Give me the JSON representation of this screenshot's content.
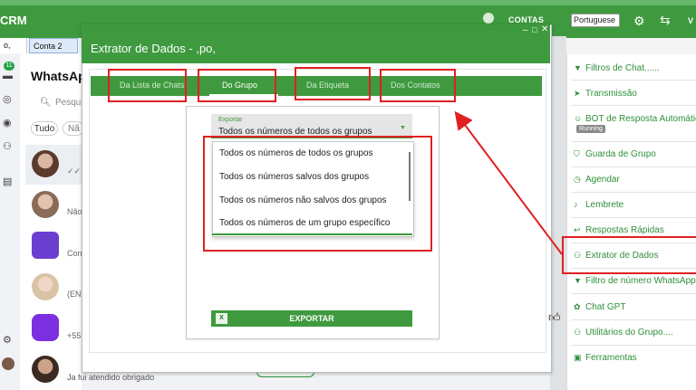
{
  "app": {
    "name": "CRM",
    "contas_label": "CONTAS",
    "language": "Portuguese",
    "user_initial": "V"
  },
  "tabs": [
    {
      "label": "o,"
    },
    {
      "label": "Conta 2"
    }
  ],
  "badge_count": "11",
  "whatsapp": {
    "title": "WhatsApp",
    "search_placeholder": "Pesqui",
    "chips": [
      "Tudo",
      "Nã"
    ],
    "snippets": [
      "✓✓ D",
      "Não",
      "Con",
      "(ENT",
      "+55",
      "Ja fui atendido obrigado"
    ]
  },
  "modal": {
    "title": "Extrator de Dados - ,po,",
    "tabs": [
      "Da Lista de Chats",
      "Do Grupo",
      "Da Etiqueta",
      "Dos Contatos"
    ],
    "select": {
      "label": "Exportar",
      "value": "Todos os números de todos os grupos",
      "options": [
        "Todos os números de todos os grupos",
        "Todos os números salvos dos grupos",
        "Todos os números não salvos dos grupos",
        "Todos os números de um grupo específico"
      ]
    },
    "export_button": "EXPORTAR"
  },
  "sidebar": {
    "items": [
      {
        "label": "Filtros de Chat......",
        "icon": "funnel-icon"
      },
      {
        "label": "Transmissão",
        "icon": "send-icon"
      },
      {
        "label": "BOT de Resposta Automátic",
        "icon": "robot-icon"
      },
      {
        "label": "Guarda de Grupo",
        "icon": "shield-icon"
      },
      {
        "label": "Agendar",
        "icon": "clock-icon"
      },
      {
        "label": "Lembrete",
        "icon": "bell-icon"
      },
      {
        "label": "Respostas Rápidas",
        "icon": "reply-icon"
      },
      {
        "label": "Extrator de Dados",
        "icon": "users-icon"
      },
      {
        "label": "Filtro de número WhatsApp",
        "icon": "funnel-icon"
      },
      {
        "label": "Chat GPT",
        "icon": "gpt-icon"
      },
      {
        "label": "Utilitários do Grupo....",
        "icon": "group-icon"
      },
      {
        "label": "Ferramentas",
        "icon": "briefcase-icon"
      }
    ],
    "running_badge": "Running"
  },
  "colors": {
    "primary_green": "#3f9a3f",
    "annotation_red": "#e02020"
  }
}
